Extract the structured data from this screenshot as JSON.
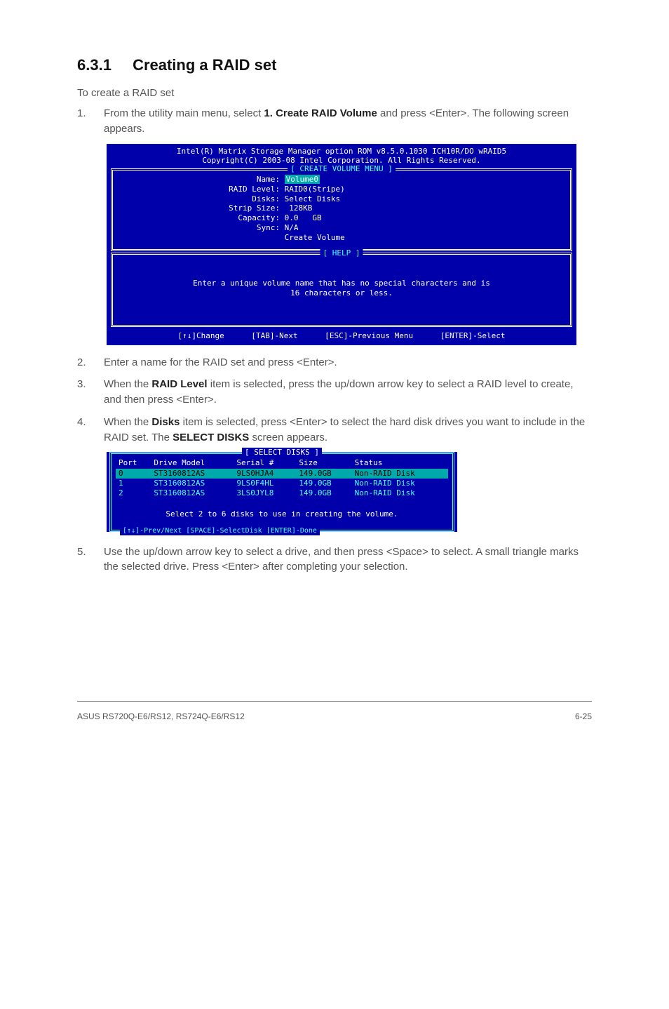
{
  "heading": {
    "num": "6.3.1",
    "title": "Creating a RAID set"
  },
  "intro": "To create a RAID set",
  "steps": {
    "s1": {
      "n": "1.",
      "pre": "From the utility main menu, select ",
      "bold": "1. Create RAID Volume",
      "post": " and press <Enter>. The following screen appears."
    },
    "s2": {
      "n": "2.",
      "text": "Enter a name for the RAID set and press <Enter>."
    },
    "s3": {
      "n": "3.",
      "pre": "When the ",
      "bold": "RAID Level",
      "post": " item is selected, press the up/down arrow key to select a RAID level to create, and then press <Enter>."
    },
    "s4": {
      "n": "4.",
      "pre": "When the ",
      "bold": "Disks",
      "mid": " item is selected, press <Enter> to select the hard disk drives you want to include in the RAID set. The ",
      "bold2": "SELECT DISKS",
      "post": " screen appears."
    },
    "s5": {
      "n": "5.",
      "text": "Use the up/down arrow key to select a drive, and then press <Space> to select. A small triangle marks the selected drive. Press <Enter> after completing your selection."
    }
  },
  "bios1": {
    "header1": "Intel(R) Matrix Storage Manager option ROM v8.5.0.1030 ICH10R/DO wRAID5",
    "header2": "Copyright(C) 2003-08 Intel Corporation.  All Rights Reserved.",
    "box1_title": "[ CREATE VOLUME MENU ]",
    "fields": {
      "name_l": "Name:",
      "name_v": "Volume0",
      "raid_l": "RAID Level:",
      "raid_v": "RAID0(Stripe)",
      "disks_l": "Disks:",
      "disks_v": "Select Disks",
      "strip_l": "Strip Size:",
      "strip_v": " 128KB",
      "cap_l": "Capacity:",
      "cap_v": "0.0   GB",
      "sync_l": "Sync:",
      "sync_v": "N/A",
      "create": "Create Volume"
    },
    "box2_title": "[ HELP ]",
    "help1": "Enter a unique volume name that has no special characters and is",
    "help2": "16 characters or less.",
    "footer": {
      "a": "[↑↓]Change",
      "b": "[TAB]-Next",
      "c": "[ESC]-Previous Menu",
      "d": "[ENTER]-Select"
    }
  },
  "bios2": {
    "title": "[ SELECT DISKS ]",
    "headers": {
      "port": "Port",
      "model": "Drive Model",
      "serial": "Serial #",
      "size": "Size",
      "status": "Status"
    },
    "rows": [
      {
        "port": "0",
        "model": "ST3160812AS",
        "serial": "9LS0HJA4",
        "size": "149.0GB",
        "status": "Non-RAID Disk",
        "sel": true
      },
      {
        "port": "1",
        "model": "ST3160812AS",
        "serial": "9LS0F4HL",
        "size": "149.0GB",
        "status": "Non-RAID Disk",
        "sel": false
      },
      {
        "port": "2",
        "model": "ST3160812AS",
        "serial": "3LS0JYL8",
        "size": "149.0GB",
        "status": "Non-RAID Disk",
        "sel": false
      }
    ],
    "msg": "Select 2 to 6 disks to use in creating the volume.",
    "footer": "[↑↓]-Prev/Next [SPACE]-SelectDisk [ENTER]-Done"
  },
  "page_footer": {
    "left": "ASUS RS720Q-E6/RS12, RS724Q-E6/RS12",
    "right": "6-25"
  }
}
